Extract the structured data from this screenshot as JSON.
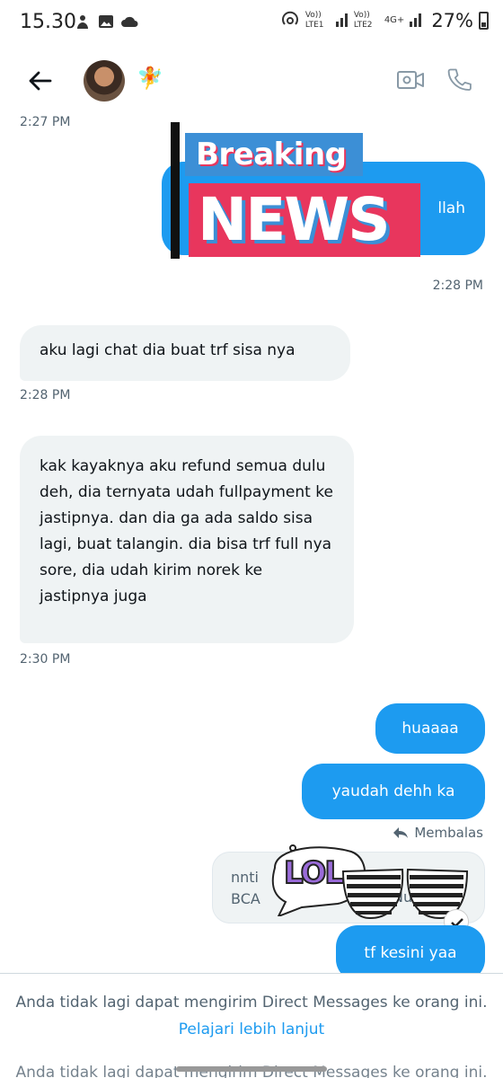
{
  "status_bar": {
    "time": "15.30",
    "sim1": "Vo)) LTE1",
    "sim2": "Vo)) LTE2",
    "network": "4G+",
    "battery": "27%"
  },
  "header": {
    "contact_emoji": "🧚"
  },
  "breaking_news": {
    "line1": "Breaking",
    "line2": "NEWS",
    "peek_text": "llah"
  },
  "messages": [
    {
      "side": "left",
      "text": "aku lagi chat dia buat trf sisa nya"
    },
    {
      "side": "left",
      "text": "kak kayaknya aku refund semua dulu deh, dia ternyata udah fullpayment ke jastipnya. dan dia ga ada saldo sisa lagi, buat talangin. dia bisa trf full nya sore, dia udah kirim norek ke jastipnya juga"
    },
    {
      "side": "right",
      "text": "huaaaa"
    },
    {
      "side": "right",
      "text": "yaudah dehh ka"
    },
    {
      "side": "right",
      "text": "tf kesini yaa"
    }
  ],
  "timestamps": {
    "t1": "2:27 PM",
    "t2": "2:28 PM",
    "t3": "2:28 PM",
    "t4": "2:30 PM"
  },
  "reply": {
    "label": "Membalas",
    "quoted_line1": "nnti",
    "quoted_line2": "BCA",
    "quoted_tail": "Nu"
  },
  "lol_sticker": "LOL",
  "footer": {
    "message": "Anda tidak lagi dapat mengirim Direct Messages ke orang ini.",
    "link": "Pelajari lebih lanjut",
    "ghost": "Anda tidak lagi dapat mengirim Direct Messages ke orang ini."
  },
  "colors": {
    "accent": "#1d9bf0",
    "bubble_left": "#eff3f4",
    "breaking_blue": "#3c8fd6",
    "breaking_pink": "#e8365d"
  }
}
